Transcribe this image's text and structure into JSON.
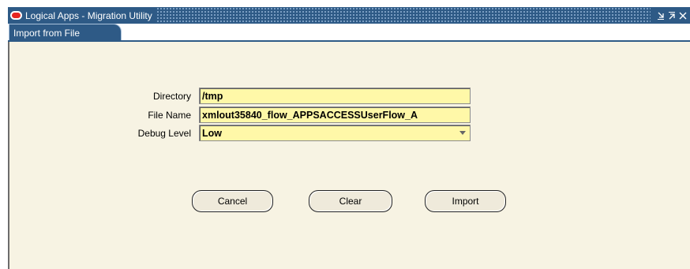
{
  "window": {
    "title": "Logical Apps - Migration Utility",
    "controls": [
      "minimize-icon",
      "maximize-icon",
      "close-icon"
    ]
  },
  "tabs": [
    {
      "label": "Import from File",
      "active": true
    }
  ],
  "form": {
    "directory": {
      "label": "Directory",
      "value": "/tmp"
    },
    "file_name": {
      "label": "File Name",
      "value": "xmlout35840_flow_APPSACCESSUserFlow_A"
    },
    "debug_level": {
      "label": "Debug Level",
      "value": "Low"
    }
  },
  "buttons": {
    "cancel": "Cancel",
    "clear": "Clear",
    "import": "Import"
  },
  "colors": {
    "titlebar": "#2e5a86",
    "field_background": "#fff8a8",
    "canvas": "#f7f3e3",
    "logo": "#e52521"
  }
}
